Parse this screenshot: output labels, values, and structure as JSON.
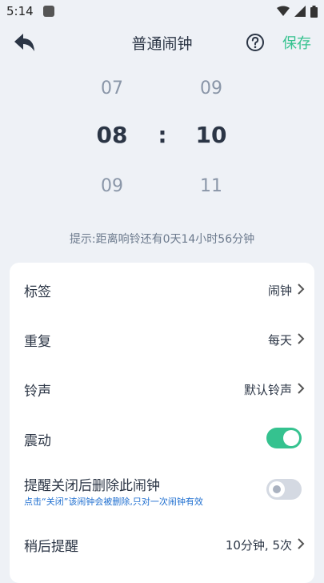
{
  "status_bar": {
    "time": "5:14"
  },
  "header": {
    "title": "普通闹钟",
    "save_label": "保存"
  },
  "picker": {
    "hour": {
      "prev": "07",
      "current": "08",
      "next": "09"
    },
    "separator": ":",
    "minute": {
      "prev": "09",
      "current": "10",
      "next": "11"
    }
  },
  "hint": "提示:距离响铃还有0天14小时56分钟",
  "settings": {
    "label": {
      "title": "标签",
      "value": "闹钟"
    },
    "repeat": {
      "title": "重复",
      "value": "每天"
    },
    "ringtone": {
      "title": "铃声",
      "value": "默认铃声"
    },
    "vibrate": {
      "title": "震动",
      "enabled": true
    },
    "delete_after": {
      "title": "提醒关闭后删除此闹钟",
      "subtitle": "点击“关闭”该闹钟会被删除,只对一次闹钟有效",
      "enabled": false
    },
    "snooze": {
      "title": "稍后提醒",
      "value": "10分钟, 5次"
    }
  },
  "colors": {
    "accent": "#35c28f",
    "background": "#eef1f6",
    "text": "#2b3545"
  }
}
